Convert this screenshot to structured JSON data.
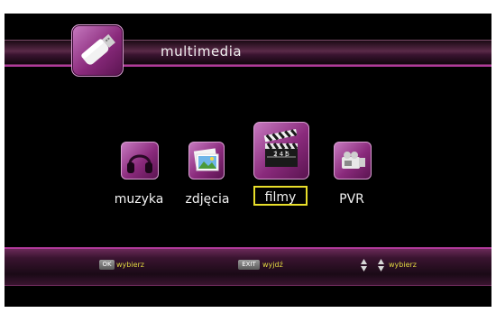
{
  "header": {
    "title": "multimedia",
    "logo_icon": "usb-stick-icon"
  },
  "menu": {
    "selected": "filmy",
    "items": [
      {
        "label": "muzyka",
        "icon": "headphones-icon"
      },
      {
        "label": "zdjęcia",
        "icon": "pictures-icon"
      },
      {
        "label": "filmy",
        "icon": "clapperboard-icon"
      },
      {
        "label": "PVR",
        "icon": "camcorder-icon"
      }
    ],
    "clapper_text": "2 4 5"
  },
  "footer": {
    "hints": [
      {
        "key": "OK",
        "label": "wybierz"
      },
      {
        "key": "EXIT",
        "label": "wyjdź"
      },
      {
        "key": "",
        "label": "wybierz",
        "icon": "up-down-arrows-icon"
      }
    ]
  },
  "colors": {
    "accent": "#b03a9a",
    "selection": "#e8de2a",
    "hint_text": "#e0d640"
  }
}
